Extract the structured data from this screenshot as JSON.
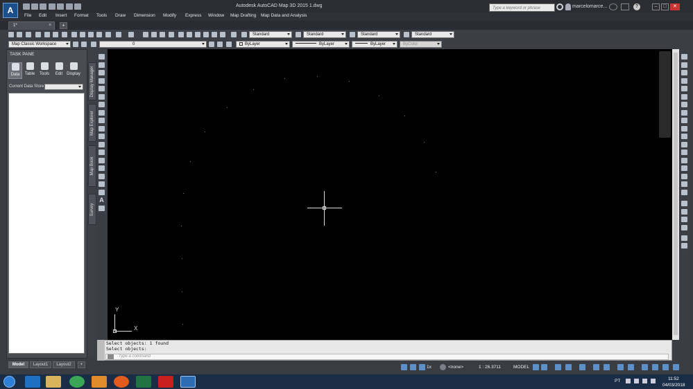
{
  "app": {
    "logo_text": "A",
    "window_title": "Autodesk AutoCAD Map 3D 2015    1.dwg",
    "search_placeholder": "Type a keyword or phrase",
    "user_name": "marcelomarce...",
    "help_label": "?",
    "window_controls": [
      "–",
      "□",
      "✕"
    ]
  },
  "menu": [
    "File",
    "Edit",
    "Insert",
    "Format",
    "Tools",
    "Draw",
    "Dimension",
    "Modify",
    "Express",
    "Window",
    "Map Drafting",
    "Map Data and Analysis"
  ],
  "doc_tabs": {
    "active": "1*",
    "close": "×",
    "new": "+"
  },
  "toolbar": {
    "text_style": "Standard",
    "dim_style": "Standard",
    "table_style": "Standard",
    "mleader_style": "Standard",
    "workspace": "Map Classic Workspace",
    "layer": "0",
    "color": "ByLayer",
    "linetype": "ByLayer",
    "lineweight": "ByLayer",
    "plotstyle": "ByColor"
  },
  "task_pane": {
    "title": "TASK PANE",
    "tabs": [
      "Data",
      "Table",
      "Tools",
      "Edit",
      "Display"
    ],
    "store_label": "Current Data Store:",
    "store_value": ""
  },
  "side_tabs": [
    "Display Manager",
    "Map Explorer",
    "Map Book",
    "Survey"
  ],
  "ucs": {
    "y": "Y",
    "x": "X"
  },
  "command": {
    "history": [
      "Select objects: 1 found",
      "Select objects:"
    ],
    "placeholder": "Type a command",
    "prompt": ">_"
  },
  "layout_tabs": [
    "Model",
    "Layout1",
    "Layout2",
    "+"
  ],
  "status": {
    "scale_mult": "1x",
    "annot": "<none>",
    "scale": "1 : 26.3711",
    "space": "MODEL"
  },
  "taskbar": {
    "lang": "PT",
    "time": "11:52",
    "date": "04/03/2018"
  },
  "colors": {
    "canvas": "#000000",
    "ui_dark": "#3b3d45",
    "accent": "#2e7fd8"
  }
}
